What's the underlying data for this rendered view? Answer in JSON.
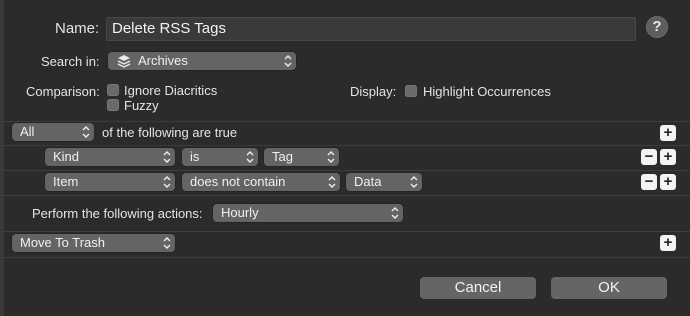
{
  "name": {
    "label": "Name:",
    "value": "Delete RSS Tags"
  },
  "help_label": "?",
  "search_in": {
    "label": "Search in:",
    "value": "Archives"
  },
  "comparison": {
    "label": "Comparison:",
    "options": [
      "Ignore Diacritics",
      "Fuzzy"
    ]
  },
  "display": {
    "label": "Display:",
    "option": "Highlight Occurrences"
  },
  "match": {
    "value": "All",
    "suffix": "of the following are true"
  },
  "conditions": [
    {
      "field": "Kind",
      "operator": "is",
      "value": "Tag"
    },
    {
      "field": "Item",
      "operator": "does not contain",
      "value": "Data"
    }
  ],
  "perform": {
    "label": "Perform the following actions:",
    "value": "Hourly"
  },
  "action": {
    "value": "Move To Trash"
  },
  "buttons": {
    "cancel": "Cancel",
    "ok": "OK",
    "plus": "+",
    "minus": "−"
  },
  "colors": {
    "background": "#2b2b2b",
    "popup": "#646464",
    "button": "#656565"
  }
}
